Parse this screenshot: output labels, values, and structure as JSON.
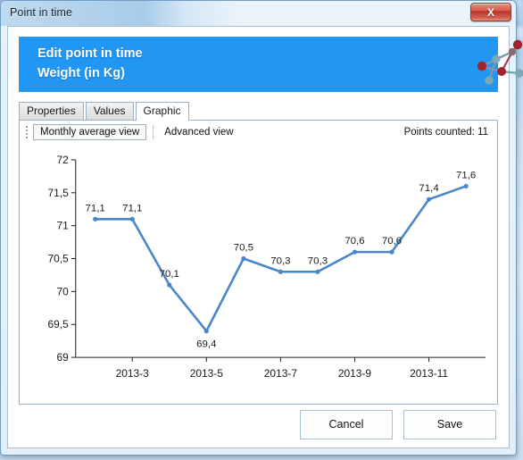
{
  "window": {
    "title": "Point in time",
    "close_label": "X"
  },
  "banner": {
    "line1": "Edit point in time",
    "line2": "Weight (in Kg)",
    "logo_icon": "molecule-network-icon"
  },
  "tabs": [
    {
      "label": "Properties",
      "active": false
    },
    {
      "label": "Values",
      "active": false
    },
    {
      "label": "Graphic",
      "active": true
    }
  ],
  "toolbar": {
    "grip_icon": "drag-grip-icon",
    "monthly_view_label": "Monthly average view",
    "advanced_view_label": "Advanced view",
    "points_counted_label": "Points counted: 11"
  },
  "footer": {
    "cancel_label": "Cancel",
    "save_label": "Save"
  },
  "colors": {
    "banner": "#2196f3",
    "series": "#4a86c8",
    "close_button": "#b93226"
  },
  "chart_data": {
    "type": "line",
    "title": "",
    "xlabel": "",
    "ylabel": "",
    "x": [
      "2013-2",
      "2013-3",
      "2013-4",
      "2013-5",
      "2013-6",
      "2013-7",
      "2013-8",
      "2013-9",
      "2013-10",
      "2013-11",
      "2013-12"
    ],
    "values": [
      71.1,
      71.1,
      70.1,
      69.4,
      70.5,
      70.3,
      70.3,
      70.6,
      70.6,
      71.4,
      71.6
    ],
    "point_labels": [
      "71,1",
      "71,1",
      "70,1",
      "69,4",
      "70,5",
      "70,3",
      "70,3",
      "70,6",
      "70,6",
      "71,4",
      "71,6"
    ],
    "ylim": [
      69,
      72
    ],
    "ytick_labels": [
      "72",
      "71,5",
      "71",
      "70,5",
      "70",
      "69,5",
      "69"
    ],
    "ytick_values": [
      72,
      71.5,
      71,
      70.5,
      70,
      69.5,
      69
    ],
    "xtick_labels": [
      "2013-3",
      "2013-5",
      "2013-7",
      "2013-9",
      "2013-11"
    ],
    "xtick_indices": [
      1,
      3,
      5,
      7,
      9
    ],
    "grid": false,
    "legend": "none",
    "markers": true,
    "data_labels": true
  }
}
